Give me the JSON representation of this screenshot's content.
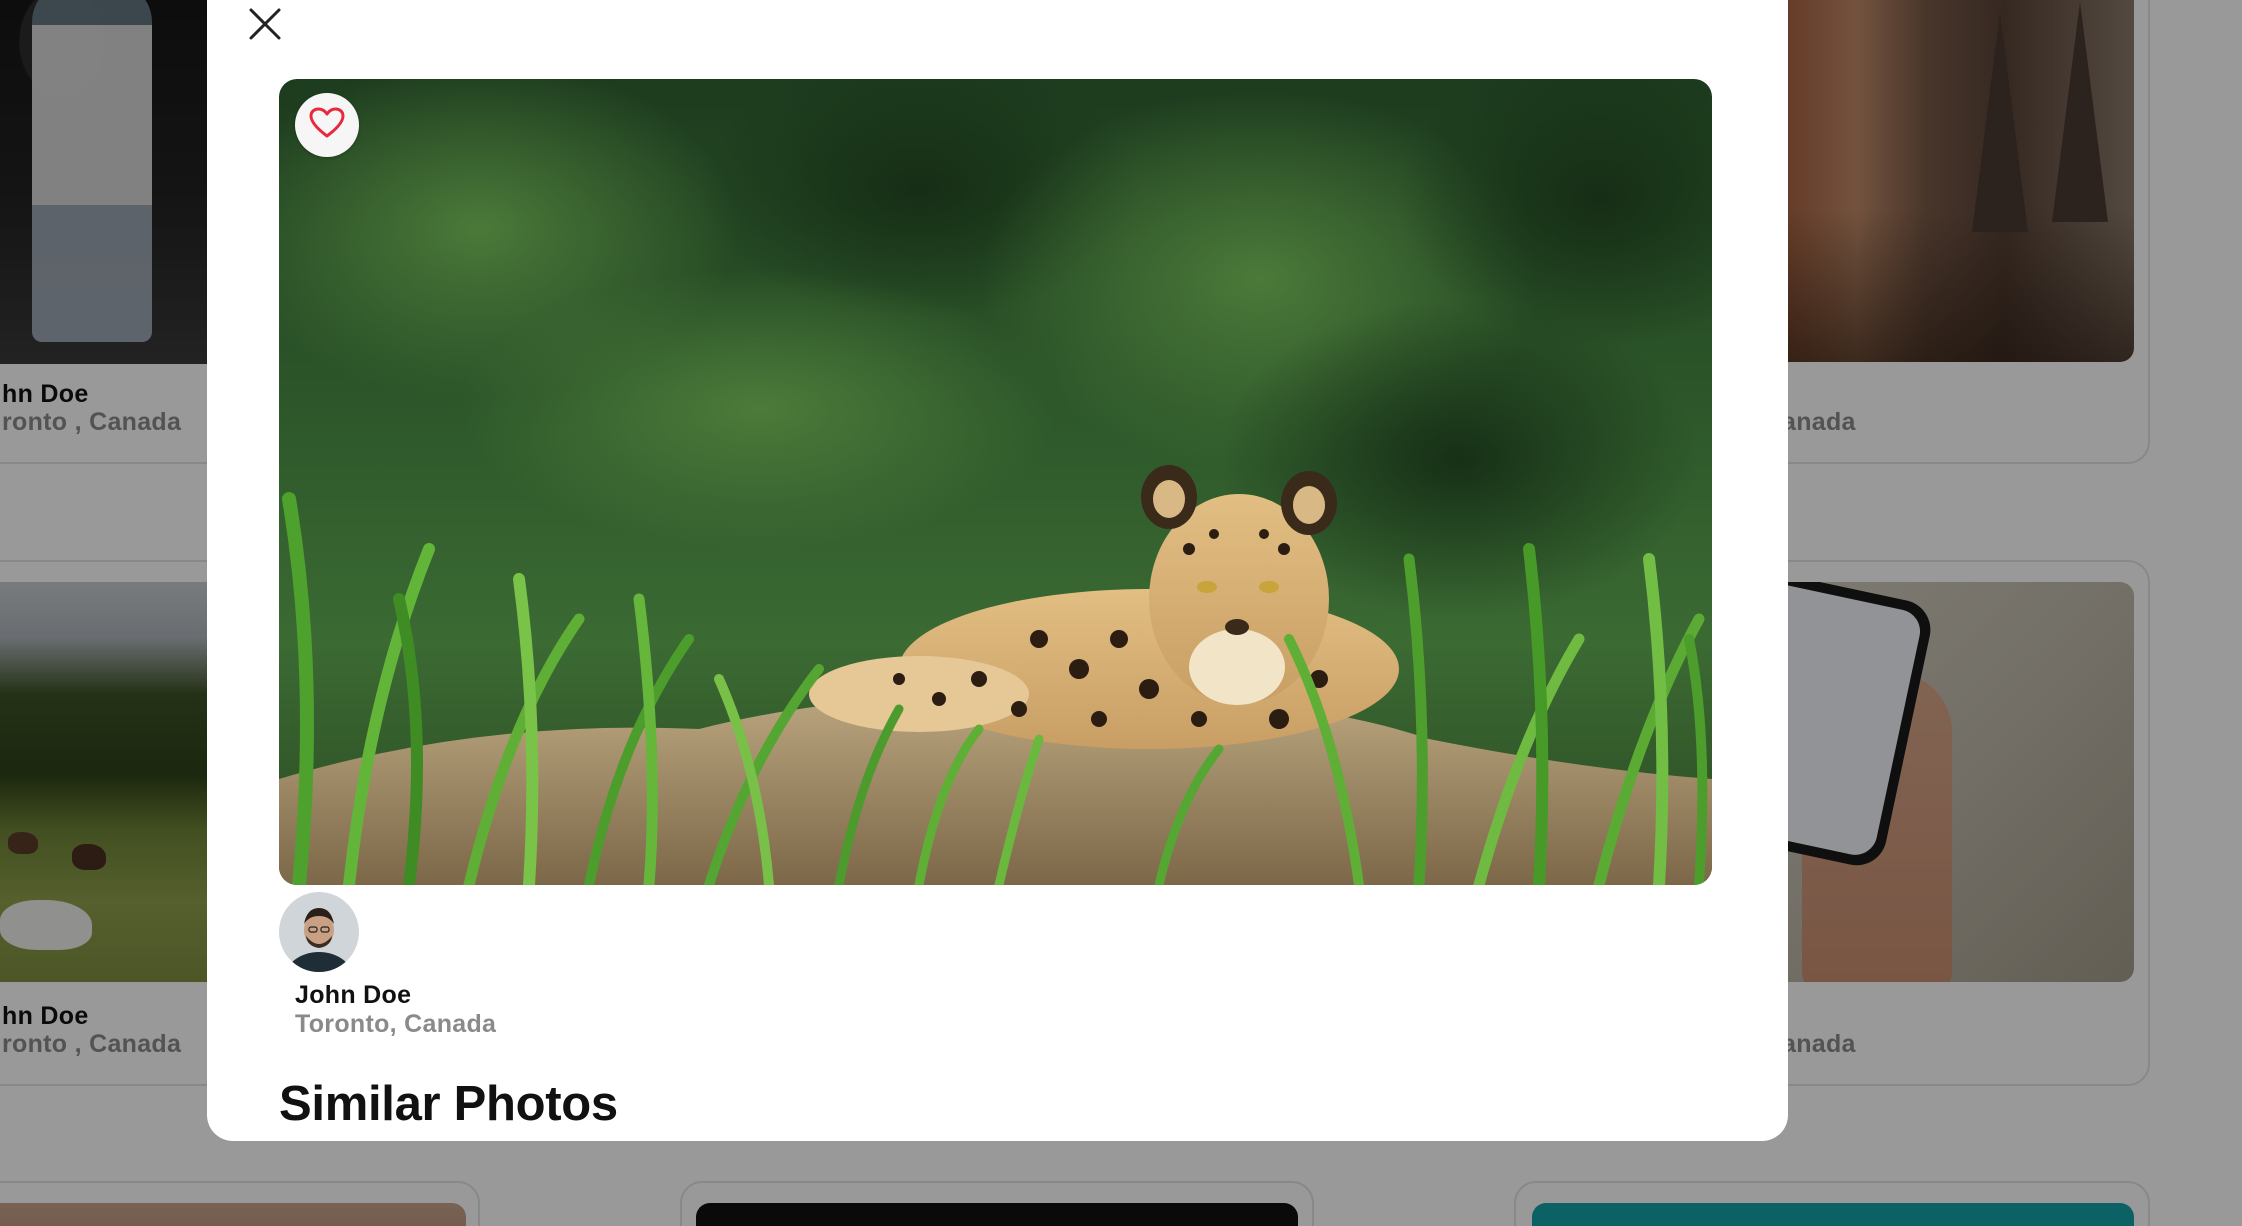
{
  "background_cards": [
    {
      "author": "John Doe",
      "location": "Toronto , Canada"
    },
    {
      "author": "John Doe",
      "location": "Toronto , Canada"
    },
    {
      "location_partial": "anada"
    },
    {
      "author": "John Doe",
      "location": "Toronto , Canada"
    },
    {
      "location_partial": "anada"
    }
  ],
  "background_text": {
    "name_row1": "hn Doe",
    "loc_row1": "ronto , Canada",
    "right_row1": "anada",
    "name_row2": "hn Doe",
    "loc_row2": "ronto , Canada",
    "right_row2": "anada"
  },
  "modal": {
    "close_icon": "close-icon",
    "like_icon": "heart-outline-icon",
    "photo_subject": "jaguar",
    "author": {
      "name": "John Doe",
      "location": "Toronto, Canada"
    },
    "similar_title": "Similar Photos"
  },
  "colors": {
    "overlay": "rgba(0,0,0,0.40)",
    "heart": "#e8283c",
    "muted_text": "#8a8a8a",
    "teal_card": "#14a2a8"
  }
}
